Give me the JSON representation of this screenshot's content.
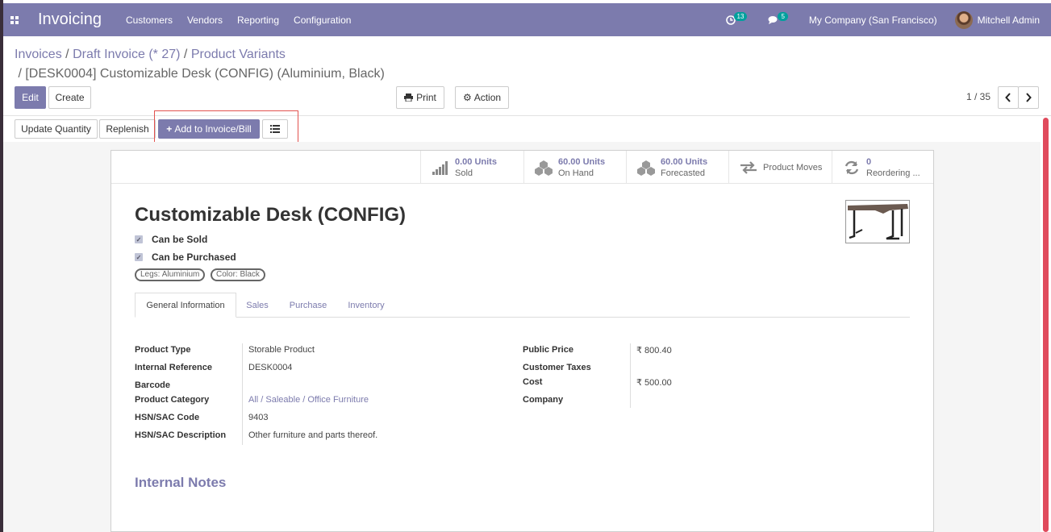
{
  "navbar": {
    "app_name": "Invoicing",
    "menu": [
      "Customers",
      "Vendors",
      "Reporting",
      "Configuration"
    ],
    "activity_count": "13",
    "message_count": "5",
    "company": "My Company (San Francisco)",
    "user": "Mitchell Admin",
    "color": "#7c7bad"
  },
  "breadcrumb": {
    "items": [
      "Invoices",
      "Draft Invoice (* 27)",
      "Product Variants"
    ],
    "current": "[DESK0004] Customizable Desk (CONFIG) (Aluminium, Black)",
    "sep": "/"
  },
  "buttons": {
    "edit": "Edit",
    "create": "Create",
    "print": "Print",
    "action": "Action",
    "update_quantity": "Update Quantity",
    "replenish": "Replenish",
    "add_to_invoice": "Add to Invoice/Bill"
  },
  "pager": {
    "text": "1 / 35"
  },
  "stats": [
    {
      "value": "0.00 Units",
      "label": "Sold",
      "icon": "bar-chart-icon"
    },
    {
      "value": "60.00 Units",
      "label": "On Hand",
      "icon": "cubes-icon"
    },
    {
      "value": "60.00 Units",
      "label": "Forecasted",
      "icon": "cubes-icon"
    },
    {
      "value": "",
      "label": "Product Moves",
      "icon": "exchange-icon"
    },
    {
      "value": "0",
      "label": "Reordering ...",
      "icon": "refresh-icon"
    }
  ],
  "product": {
    "title": "Customizable Desk (CONFIG)",
    "can_be_sold": "Can be Sold",
    "can_be_purchased": "Can be Purchased",
    "tags": [
      "Legs: Aluminium",
      "Color: Black"
    ]
  },
  "tabs": [
    "General Information",
    "Sales",
    "Purchase",
    "Inventory"
  ],
  "fields_left": [
    {
      "label": "Product Type",
      "value": "Storable Product"
    },
    {
      "label": "Internal Reference",
      "value": "DESK0004"
    },
    {
      "label": "Barcode",
      "value": ""
    },
    {
      "label": "Product Category",
      "value": "All / Saleable / Office Furniture"
    },
    {
      "label": "HSN/SAC Code",
      "value": "9403"
    },
    {
      "label": "HSN/SAC Description",
      "value": "Other furniture and parts thereof."
    }
  ],
  "fields_right": [
    {
      "label": "Public Price",
      "value": "₹ 800.40"
    },
    {
      "label": "Customer Taxes",
      "value": ""
    },
    {
      "label": "Cost",
      "value": "₹ 500.00"
    },
    {
      "label": "Company",
      "value": ""
    }
  ],
  "section": {
    "internal_notes": "Internal Notes"
  }
}
